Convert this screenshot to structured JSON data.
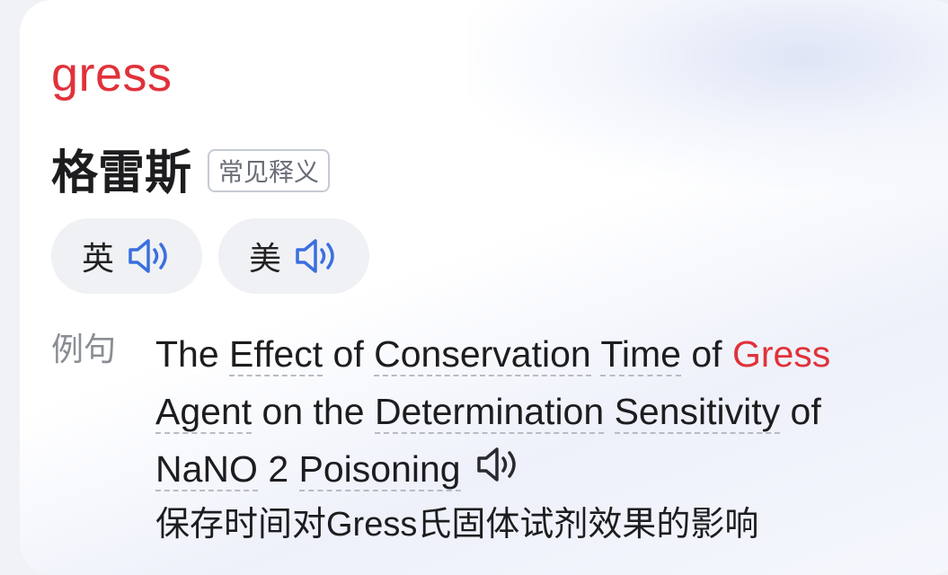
{
  "entry": {
    "word": "gress",
    "meaning": "格雷斯",
    "meaning_tag": "常见释义"
  },
  "pronunciations": [
    {
      "label": "英",
      "icon": "speaker-icon"
    },
    {
      "label": "美",
      "icon": "speaker-icon"
    }
  ],
  "example": {
    "label": "例句",
    "line1": {
      "t1": "The ",
      "w1": "Effect",
      "t2": " of ",
      "w2": "Conservation",
      "t3": " ",
      "w3": "Time",
      "t4": " of ",
      "hl": "Gress"
    },
    "line2": {
      "w1": "Agent",
      "t1": " on the ",
      "w2": "Determination",
      "t2": " ",
      "w3": "Sensitivity",
      "t3": " of"
    },
    "line3": {
      "w1": "NaNO",
      "t1": " 2 ",
      "w2": "Poisoning"
    },
    "translation": "保存时间对Gress氏固体试剂效果的影响"
  },
  "colors": {
    "highlight": "#e0323a",
    "speaker": "#3b6fe0"
  }
}
